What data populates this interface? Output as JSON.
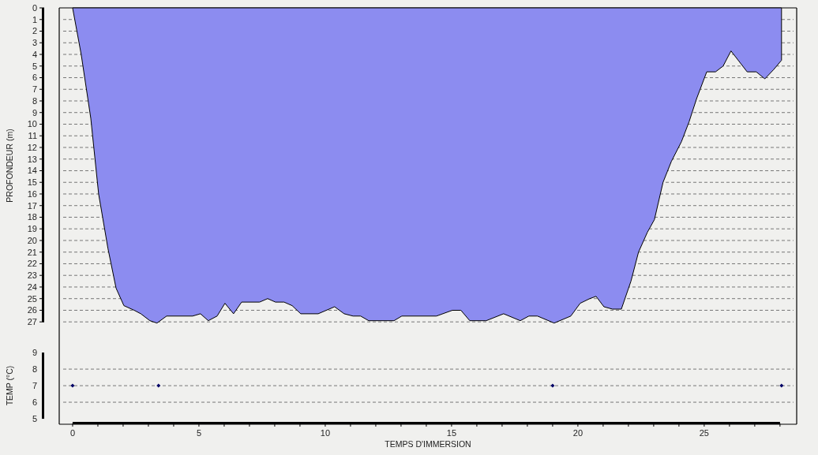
{
  "depth_panel": {
    "chart_data": {
      "type": "area",
      "ylabel": "PROFONDEUR (m)",
      "grid": true,
      "xlim": [
        -0.53,
        28.66
      ],
      "ylim": [
        27.8,
        0
      ],
      "x": [
        0,
        0.34,
        0.72,
        1.03,
        1.4,
        1.72,
        2.03,
        2.44,
        2.7,
        3.06,
        3.34,
        3.72,
        4.75,
        5.06,
        5.37,
        5.72,
        6.03,
        6.37,
        6.69,
        7.4,
        7.72,
        8.03,
        8.37,
        8.69,
        9.03,
        9.72,
        10.37,
        10.75,
        11.1,
        11.4,
        11.72,
        12.72,
        13.03,
        14.4,
        15.03,
        15.37,
        15.72,
        16.37,
        17.06,
        17.72,
        18.06,
        18.4,
        19.06,
        19.72,
        20.09,
        20.47,
        20.72,
        21.03,
        21.37,
        21.72,
        22.1,
        22.4,
        22.75,
        23.03,
        23.37,
        23.7,
        24.1,
        24.4,
        24.7,
        25.1,
        25.45,
        25.75,
        26.06,
        26.7,
        27.06,
        27.4,
        27.75,
        28.06,
        28.06
      ],
      "series": [
        {
          "color": "#8c8cf0",
          "values": [
            0,
            4,
            9.5,
            16,
            20.7,
            24.1,
            25.6,
            26,
            26.3,
            26.9,
            27.1,
            26.5,
            26.5,
            26.3,
            26.9,
            26.5,
            25.4,
            26.3,
            25.3,
            25.3,
            25,
            25.3,
            25.3,
            25.6,
            26.3,
            26.3,
            25.7,
            26.3,
            26.5,
            26.5,
            26.9,
            26.9,
            26.5,
            26.5,
            26,
            26,
            26.9,
            26.9,
            26.3,
            26.9,
            26.5,
            26.5,
            27.1,
            26.5,
            25.4,
            25,
            24.8,
            25.7,
            25.9,
            25.9,
            23.5,
            21,
            19.3,
            18.2,
            15,
            13.2,
            11.5,
            9.8,
            7.8,
            5.5,
            5.5,
            5,
            3.7,
            5.5,
            5.5,
            6.1,
            5.3,
            4.5,
            0
          ]
        }
      ],
      "yticks": [
        0,
        1,
        2,
        3,
        4,
        5,
        6,
        7,
        8,
        9,
        10,
        11,
        12,
        13,
        14,
        15,
        16,
        17,
        18,
        19,
        20,
        21,
        22,
        23,
        24,
        25,
        26,
        27
      ]
    }
  },
  "temperature_panel": {
    "chart_data": {
      "type": "scatter",
      "ylabel": "TEMP (°C)",
      "xlabel": "TEMPS D'IMMERSION",
      "grid": true,
      "xlim": [
        -0.53,
        28.66
      ],
      "ylim": [
        4.67,
        10.29
      ],
      "x": [
        0,
        3.4,
        19,
        28.06
      ],
      "series": [
        {
          "color": "#000066",
          "values": [
            7,
            7,
            7,
            7
          ]
        }
      ],
      "yticks": [
        5,
        6,
        7,
        8,
        9
      ],
      "xticks": [
        0,
        5,
        10,
        15,
        20,
        25
      ]
    }
  }
}
